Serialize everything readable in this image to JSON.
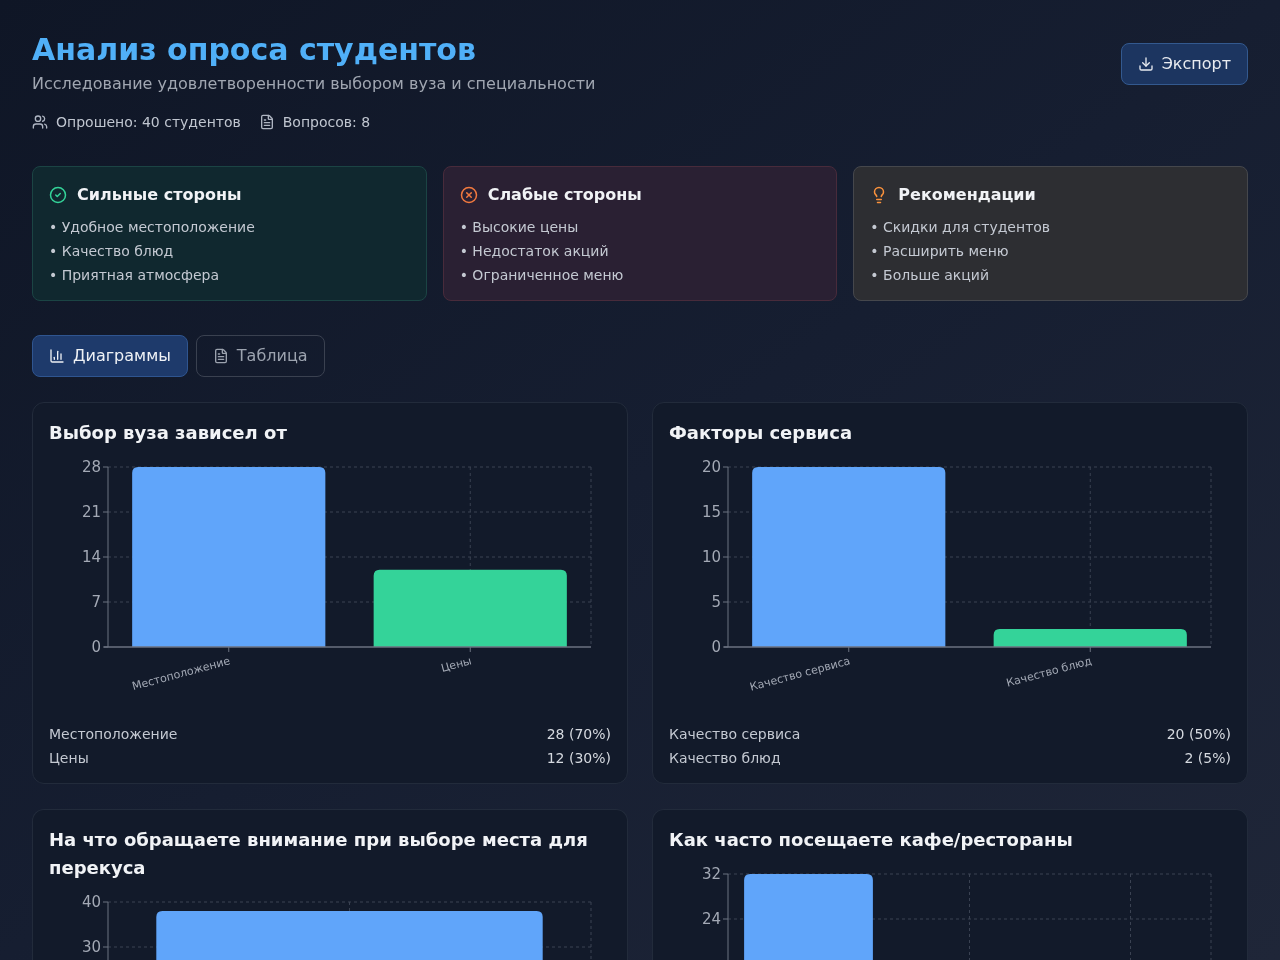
{
  "header": {
    "title": "Анализ опроса студентов",
    "subtitle": "Исследование удовлетворенности выбором вуза и специальности",
    "stats": [
      {
        "kind": "respondents",
        "text": "Опрошено: 40 студентов"
      },
      {
        "kind": "questions",
        "text": "Вопросов: 8"
      }
    ],
    "export_button": "Экспорт"
  },
  "insights": [
    {
      "kind": "strengths",
      "title": "Сильные стороны",
      "items": [
        "• Удобное местоположение",
        "• Качество блюд",
        "• Приятная атмосфера"
      ]
    },
    {
      "kind": "weaknesses",
      "title": "Слабые стороны",
      "items": [
        "• Высокие цены",
        "• Недостаток акций",
        "• Ограниченное меню"
      ]
    },
    {
      "kind": "recommendations",
      "title": "Рекомендации",
      "items": [
        "• Скидки для студентов",
        "• Расширить меню",
        "• Больше акций"
      ]
    }
  ],
  "tabs": [
    {
      "kind": "charts",
      "label": "Диаграммы",
      "selected": true
    },
    {
      "kind": "table",
      "label": "Таблица",
      "selected": false
    }
  ],
  "charts": [
    {
      "chart_data": {
        "type": "bar",
        "title": "Выбор вуза зависел от",
        "categories": [
          "Местоположение",
          "Цены"
        ],
        "values": [
          28,
          12
        ],
        "colors": [
          "#60a5fa",
          "#34d399"
        ],
        "ylim": [
          0,
          28
        ],
        "yticks": [
          0,
          7,
          14,
          21,
          28
        ],
        "grid": true
      },
      "legend": [
        {
          "label": "Местоположение",
          "value": "28 (70%)"
        },
        {
          "label": "Цены",
          "value": "12 (30%)"
        }
      ]
    },
    {
      "chart_data": {
        "type": "bar",
        "title": "Факторы сервиса",
        "categories": [
          "Качество сервиса",
          "Качество блюд"
        ],
        "values": [
          20,
          2
        ],
        "colors": [
          "#60a5fa",
          "#34d399"
        ],
        "ylim": [
          0,
          20
        ],
        "yticks": [
          0,
          5,
          10,
          15,
          20
        ],
        "grid": true
      },
      "legend": [
        {
          "label": "Качество сервиса",
          "value": "20 (50%)"
        },
        {
          "label": "Качество блюд",
          "value": "2 (5%)"
        }
      ]
    },
    {
      "chart_data": {
        "type": "bar",
        "title": "На что обращаете внимание при выборе места для перекуса",
        "values": [
          38
        ],
        "colors": [
          "#60a5fa"
        ],
        "ylim": [
          0,
          40
        ],
        "yticks": [
          30,
          40
        ],
        "grid": true
      }
    },
    {
      "chart_data": {
        "type": "bar",
        "title": "Как часто посещаете кафе/рестораны",
        "values": [
          32,
          null,
          null
        ],
        "colors": [
          "#60a5fa",
          null,
          null
        ],
        "ylim": [
          0,
          32
        ],
        "yticks": [
          24,
          32
        ],
        "grid": true
      }
    }
  ]
}
